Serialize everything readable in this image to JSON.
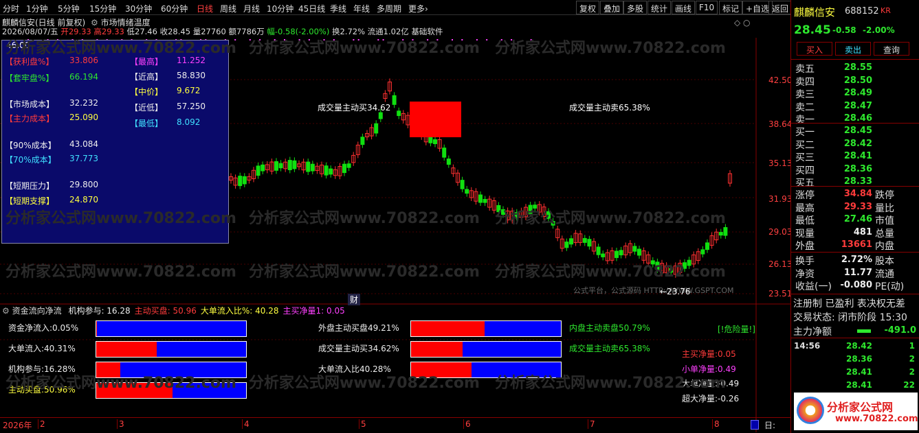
{
  "toolbar": {
    "periods": [
      "分时",
      "1分钟",
      "5分钟",
      "15分钟",
      "30分钟",
      "60分钟",
      "日线",
      "周线",
      "月线",
      "10分钟",
      "45日线",
      "季线",
      "年线",
      "多周期",
      "更多›"
    ],
    "active": "日线",
    "buttons": [
      "复权",
      "叠加",
      "多股",
      "统计",
      "画线",
      "F10",
      "标记",
      "+自选",
      "返回"
    ]
  },
  "header": {
    "stock_title": "麒麟信安(日线 前复权)",
    "indicator_name": "市场情绪温度"
  },
  "infoline": {
    "date": "2026/08/07/五",
    "open": "开29.33",
    "high": "高29.33",
    "low": "低27.46",
    "close": "收28.45",
    "vol": "量27760",
    "amt": "额7786万",
    "chg": "幅-0.58(-2.00%)",
    "turnover": "换2.72%",
    "float": "流通1.02亿",
    "tag": "基础软件"
  },
  "chip": {
    "top_value": "46.00",
    "rows": [
      {
        "label": "【获利盘%】",
        "value": "33.806",
        "lc": "red",
        "vc": "red",
        "col": 0
      },
      {
        "label": "【套牢盘%】",
        "value": "66.194",
        "lc": "green",
        "vc": "green",
        "col": 0
      },
      {
        "label": "【市场成本】",
        "value": "32.232",
        "lc": "white",
        "vc": "white",
        "col": 0
      },
      {
        "label": "【主力成本】",
        "value": "25.090",
        "lc": "red",
        "vc": "yellow",
        "col": 0
      },
      {
        "label": "【90%成本】",
        "value": "43.084",
        "lc": "white",
        "vc": "white",
        "col": 0
      },
      {
        "label": "【70%成本】",
        "value": "37.773",
        "lc": "cyan",
        "vc": "cyan",
        "col": 0
      },
      {
        "label": "【短期压力】",
        "value": "29.800",
        "lc": "white",
        "vc": "white",
        "col": 0
      },
      {
        "label": "【短期支撑】",
        "value": "24.870",
        "lc": "yellow",
        "vc": "yellow",
        "col": 0
      },
      {
        "label": "【最高】",
        "value": "11.252",
        "lc": "mag",
        "vc": "mag",
        "col": 1
      },
      {
        "label": "【近高】",
        "value": "58.830",
        "lc": "white",
        "vc": "white",
        "col": 1
      },
      {
        "label": "【中价】",
        "value": "9.672",
        "lc": "yellow",
        "vc": "yellow",
        "col": 1
      },
      {
        "label": "【近低】",
        "value": "57.250",
        "lc": "white",
        "vc": "white",
        "col": 1
      },
      {
        "label": "【最低】",
        "value": "8.092",
        "lc": "cyan",
        "vc": "cyan",
        "col": 1
      }
    ]
  },
  "price_axis": [
    "42.50",
    "38.64",
    "35.13",
    "31.93",
    "29.03",
    "26.13",
    "23.51"
  ],
  "main_chart": {
    "buy_label": "成交量主动买34.62",
    "sell_label": "成交量主动卖65.38%",
    "low_mark": "←23.76",
    "fin_badge": "财",
    "site": "公式平台，公式源码 HTTP://WWW.GSPT.COM"
  },
  "watermark": "分析家公式网www.70822.com",
  "lower": {
    "title": "资金流向净流",
    "items": [
      {
        "t": "机构参与: 16.28",
        "c": "white"
      },
      {
        "t": "主动买盘: 50.96",
        "c": "red"
      },
      {
        "t": "大单流入比%: 40.28",
        "c": "yellow"
      },
      {
        "t": "主买净量1: 0.05",
        "c": "mag"
      }
    ],
    "bars": [
      {
        "label": "资金净流入:0.05%",
        "pct": 0.0005,
        "lc": "white"
      },
      {
        "label": "大单流入:40.31%",
        "pct": 0.4031,
        "lc": "white"
      },
      {
        "label": "机构参与:16.28%",
        "pct": 0.1628,
        "lc": "white"
      },
      {
        "label": "主动买盘:50.96%",
        "pct": 0.5096,
        "lc": "yellow"
      },
      {
        "label": "外盘主动买盘49.21%",
        "pct": 0.4921,
        "lc": "white"
      },
      {
        "label": "成交量主动买34.62%",
        "pct": 0.3462,
        "lc": "white"
      },
      {
        "label": "大单流入比40.28%",
        "pct": 0.4028,
        "lc": "white"
      }
    ],
    "right_labels": [
      {
        "t": "内盘主动卖盘50.79%",
        "c": "green"
      },
      {
        "t": "成交量主动卖65.38%",
        "c": "green"
      }
    ],
    "danger": "[!危险量!]",
    "netlabels": [
      {
        "t": "主买净量:0.05",
        "c": "red"
      },
      {
        "t": "小单净量:0.49",
        "c": "mag"
      },
      {
        "t": "大单净量:-0.49",
        "c": "white"
      },
      {
        "t": "超大净量:-0.26",
        "c": "white"
      }
    ]
  },
  "date_axis": {
    "year": "2026年",
    "ticks": [
      "2",
      "3",
      "4",
      "5",
      "6",
      "7",
      "8"
    ],
    "end": "日:"
  },
  "quote": {
    "name": "麒麟信安",
    "code": "688152",
    "kr": "KR",
    "price": "28.45",
    "chg": "-0.58",
    "pct": "-2.00%",
    "buttons": [
      "买入",
      "卖出",
      "查询"
    ],
    "asks": [
      {
        "l": "卖五",
        "p": "28.55"
      },
      {
        "l": "卖四",
        "p": "28.50"
      },
      {
        "l": "卖三",
        "p": "28.49"
      },
      {
        "l": "卖二",
        "p": "28.47"
      },
      {
        "l": "卖一",
        "p": "28.46"
      }
    ],
    "bids": [
      {
        "l": "买一",
        "p": "28.45"
      },
      {
        "l": "买二",
        "p": "28.42"
      },
      {
        "l": "买三",
        "p": "28.41"
      },
      {
        "l": "买四",
        "p": "28.36"
      },
      {
        "l": "买五",
        "p": "28.33"
      }
    ],
    "stats": [
      {
        "l": "涨停",
        "v": "34.84",
        "vc": "red",
        "r": "跌停"
      },
      {
        "l": "最高",
        "v": "29.33",
        "vc": "red",
        "r": "量比"
      },
      {
        "l": "最低",
        "v": "27.46",
        "vc": "green",
        "r": "市值"
      },
      {
        "l": "现量",
        "v": "481",
        "vc": "white",
        "r": "总量"
      },
      {
        "l": "外盘",
        "v": "13661",
        "vc": "red",
        "r": "内盘"
      }
    ],
    "stats2": [
      {
        "l": "换手",
        "v": "2.72%",
        "r": "股本"
      },
      {
        "l": "净资",
        "v": "11.77",
        "r": "流通"
      },
      {
        "l": "收益(一)",
        "v": "-0.080",
        "r": "PE(动)"
      }
    ],
    "reg": "注册制 已盈利 表决权无差",
    "trade_state": "交易状态: 闭市阶段 15:30",
    "main_net_label": "主力净额",
    "main_net": "-491.0",
    "ticks": [
      {
        "t": "14:56",
        "p": "28.42",
        "v": "1"
      },
      {
        "t": "",
        "p": "28.36",
        "v": "2"
      },
      {
        "t": "",
        "p": "28.41",
        "v": "2"
      },
      {
        "t": "",
        "p": "28.41",
        "v": "22"
      },
      {
        "t": "",
        "p": "28.41",
        "v": "1"
      }
    ],
    "logo": "分析家公式网",
    "logo_url": "www.70822.com"
  }
}
